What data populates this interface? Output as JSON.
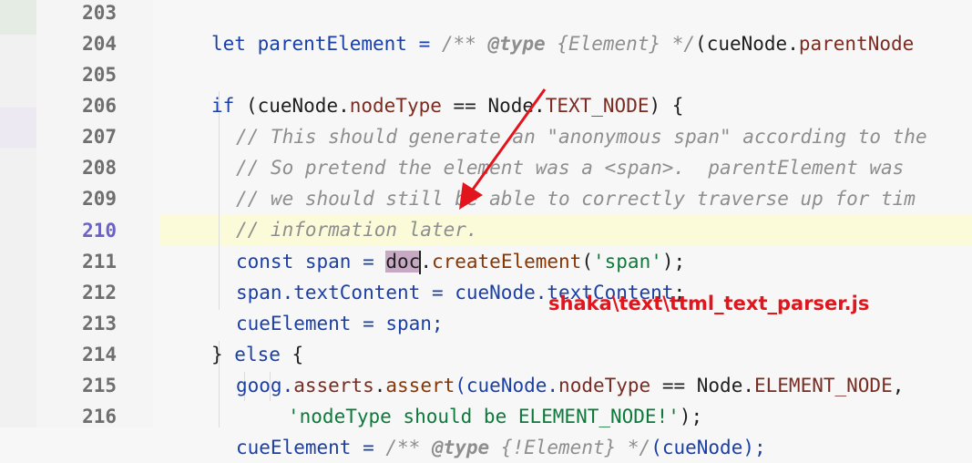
{
  "lines": [
    {
      "number": "203"
    },
    {
      "number": "204"
    },
    {
      "number": "205"
    },
    {
      "number": "206"
    },
    {
      "number": "207"
    },
    {
      "number": "208"
    },
    {
      "number": "209"
    },
    {
      "number": "210"
    },
    {
      "number": "211"
    },
    {
      "number": "212"
    },
    {
      "number": "213"
    },
    {
      "number": "214"
    },
    {
      "number": "215"
    },
    {
      "number": "216"
    }
  ],
  "code": {
    "l203": {
      "t1": "let parentElement = ",
      "t2": "/** ",
      "t3": "@type",
      "t4": " {Element} */",
      "t5": "(cueNode.",
      "t6": "parentNode"
    },
    "l205": {
      "t1": "if",
      "t2": " (cueNode.",
      "t3": "nodeType",
      "t4": " == Node.",
      "t5": "TEXT_NODE",
      "t6": ") {"
    },
    "l206": "// This should generate an \"anonymous span\" according to the",
    "l207": "// So pretend the element was a <span>.  parentElement was",
    "l208": "// we should still be able to correctly traverse up for tim",
    "l209": "// information later.",
    "l210": {
      "t1": "const span = ",
      "sel": "doc",
      "t2": ".",
      "t3": "createElement",
      "t4": "(",
      "t5": "'span'",
      "t6": ");"
    },
    "l211": {
      "t1": "span.",
      "t2": "textContent",
      "t3": " = cueNode.",
      "t4": "textContent",
      "t5": ";"
    },
    "l212": "cueElement = span;",
    "l213": {
      "t1": "} ",
      "t2": "else",
      "t3": " {"
    },
    "l214": {
      "t1": "goog.",
      "t2": "asserts",
      "t3": ".",
      "t4": "assert",
      "t5": "(cueNode.",
      "t6": "nodeType",
      "t7": " == Node.",
      "t8": "ELEMENT_NODE",
      "t9": ","
    },
    "l215": {
      "t1": "'nodeType should be ELEMENT_NODE!'",
      "t2": ");"
    },
    "l216": {
      "t1": "cueElement = ",
      "t2": "/** ",
      "t3": "@type",
      "t4": " {!Element} */",
      "t5": "(cueNode);"
    }
  },
  "annotation": {
    "text": "shaka\\text\\ttml_text_parser.js",
    "color": "#e2141c"
  },
  "colors": {
    "keyword": "#1a3fa6",
    "string": "#0c7a3a",
    "comment": "#8e8e8e",
    "selection": "#c7a9c4",
    "current_line": "#fbfbd9"
  }
}
